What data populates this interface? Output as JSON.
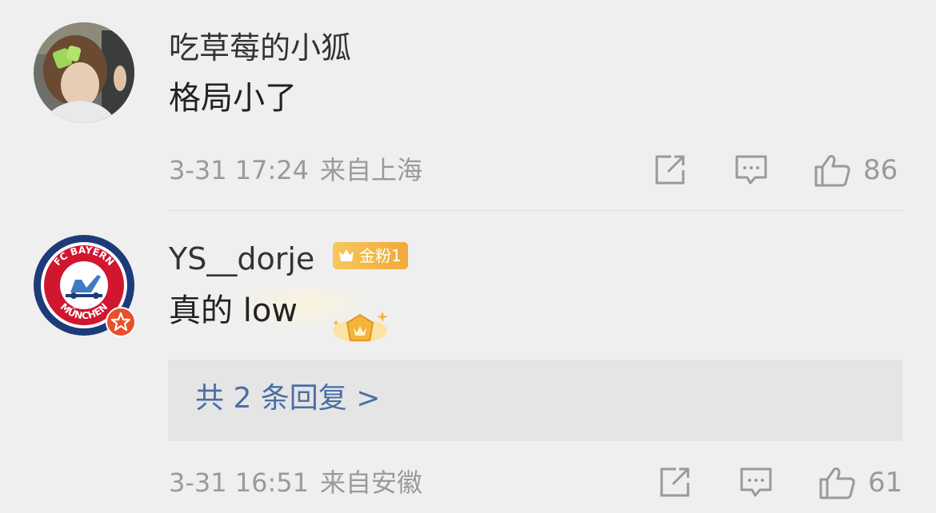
{
  "comments": [
    {
      "username": "吃草莓的小狐",
      "content": "格局小了",
      "date": "3-31 17:24",
      "location": "来自上海",
      "likes": "86",
      "avatar_desc": "child-photo-avatar"
    },
    {
      "username": "YS__dorje",
      "badge": "金粉1",
      "content": "真的 low",
      "replies_link": "共 2 条回复 >",
      "date": "3-31 16:51",
      "location": "来自安徽",
      "likes": "61",
      "avatar_text_top": "FC BAYERN",
      "avatar_text_bottom": "MÜNCHEN"
    }
  ],
  "colors": {
    "background": "#efefef",
    "link": "#4a6fa5",
    "meta": "#9a9a9a",
    "badge": "#f1a93a",
    "verified": "#e8502c",
    "bayern_blue": "#1c3b78",
    "bayern_red": "#d1162f"
  }
}
